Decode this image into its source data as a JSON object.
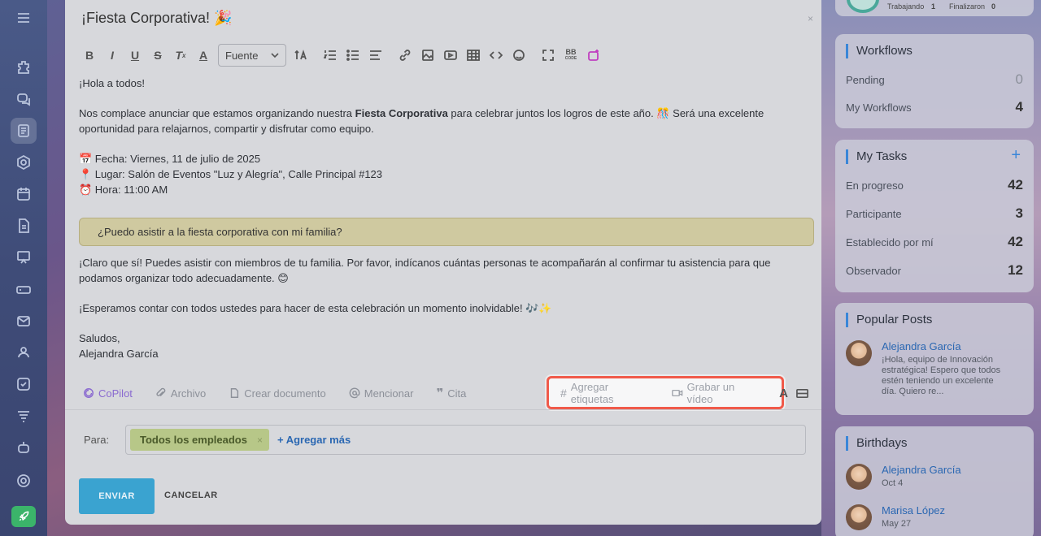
{
  "post": {
    "title": "¡Fiesta Corporativa! 🎉",
    "close": "×",
    "font_select": "Fuente",
    "greeting": "¡Hola a todos!",
    "intro_before": "Nos complace anunciar que estamos organizando nuestra ",
    "intro_bold": "Fiesta Corporativa",
    "intro_after": " para celebrar juntos los logros de este año. 🎊 Será una excelente",
    "intro_line2": "oportunidad para relajarnos, compartir y disfrutar como equipo.",
    "fecha": "📅 Fecha: Viernes, 11 de julio de 2025",
    "lugar": "📍 Lugar: Salón de Eventos \"Luz y Alegría\", Calle Principal #123",
    "hora": "⏰ Hora: 11:00 AM",
    "quote": "¿Puedo asistir a la fiesta corporativa con mi familia?",
    "answer_line1": "¡Claro que sí! Puedes asistir con miembros de tu familia. Por favor, indícanos cuántas personas te acompañarán al confirmar tu asistencia para que",
    "answer_line2": "podamos organizar todo adecuadamente. 😊",
    "closing": "¡Esperamos contar con todos ustedes para hacer de esta celebración un momento inolvidable! 🎶✨",
    "saludos": "Saludos,",
    "signature": "Alejandra García"
  },
  "actions": {
    "copilot": "CoPilot",
    "archivo": "Archivo",
    "crear_documento": "Crear documento",
    "mencionar": "Mencionar",
    "cita": "Cita",
    "agregar_etiquetas": "Agregar etiquetas",
    "grabar_video": "Grabar un vídeo",
    "text_format": "A"
  },
  "recipients": {
    "label": "Para:",
    "chip": "Todos los empleados",
    "chip_remove": "×",
    "add_more": "+ Agregar más"
  },
  "buttons": {
    "send": "ENVIAR",
    "cancel": "CANCELAR"
  },
  "top_widget": {
    "trabajando": "Trabajando",
    "trabajando_count": "1",
    "finalizaron": "Finalizaron",
    "finalizaron_count": "0"
  },
  "workflows": {
    "title": "Workflows",
    "pending_label": "Pending",
    "pending_value": "0",
    "my_label": "My Workflows",
    "my_value": "4"
  },
  "tasks": {
    "title": "My Tasks",
    "add": "+",
    "items": [
      {
        "label": "En progreso",
        "value": "42"
      },
      {
        "label": "Participante",
        "value": "3"
      },
      {
        "label": "Establecido por mí",
        "value": "42"
      },
      {
        "label": "Observador",
        "value": "12"
      }
    ]
  },
  "popular": {
    "title": "Popular Posts",
    "author": "Alejandra García",
    "excerpt": "¡Hola, equipo de Innovación estratégica! Espero que todos estén teniendo un excelente día. Quiero re..."
  },
  "birthdays": {
    "title": "Birthdays",
    "people": [
      {
        "name": "Alejandra García",
        "date": "Oct 4"
      },
      {
        "name": "Marisa López",
        "date": "May 27"
      }
    ]
  },
  "colors": {
    "accent": "#3a86d8",
    "highlight": "#f05a4a",
    "send": "#3aa3d0",
    "chip": "#b7c788"
  }
}
